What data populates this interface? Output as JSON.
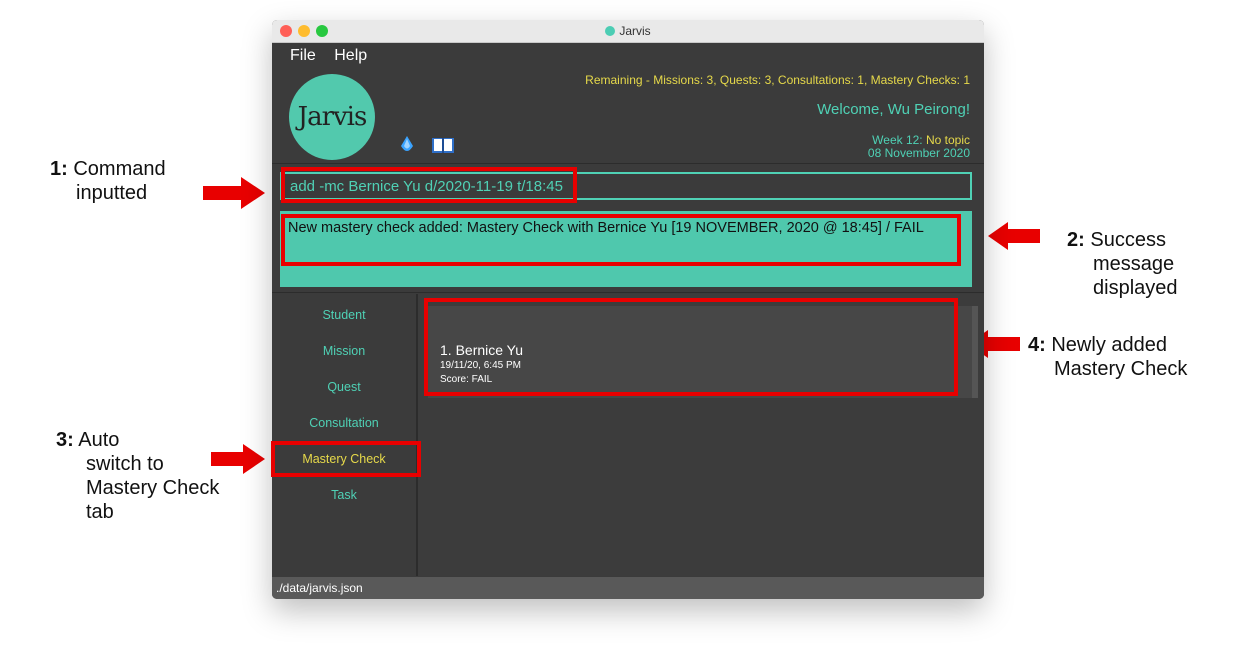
{
  "window": {
    "title": "Jarvis"
  },
  "menu": {
    "file": "File",
    "help": "Help"
  },
  "header": {
    "logo_text": "Jarvis",
    "remaining": "Remaining - Missions: 3, Quests: 3, Consultations: 1, Mastery Checks: 1",
    "welcome": "Welcome, Wu Peirong!",
    "week_label": "Week 12: ",
    "week_topic": "No topic",
    "date": "08 November 2020"
  },
  "command": {
    "value": "add -mc Bernice Yu d/2020-11-19 t/18:45"
  },
  "result": {
    "message": "New mastery check added: Mastery Check with Bernice Yu [19 NOVEMBER, 2020 @ 18:45] / FAIL"
  },
  "tabs": [
    {
      "label": "Student"
    },
    {
      "label": "Mission"
    },
    {
      "label": "Quest"
    },
    {
      "label": "Consultation"
    },
    {
      "label": "Mastery Check",
      "active": true
    },
    {
      "label": "Task"
    }
  ],
  "list": [
    {
      "name": "1.  Bernice Yu",
      "datetime": "19/11/20, 6:45 PM",
      "score": "Score: FAIL"
    }
  ],
  "status": {
    "path": "./data/jarvis.json"
  },
  "annotations": {
    "a1_num": "1:",
    "a1_line1": "Command",
    "a1_line2": "inputted",
    "a2_num": "2:",
    "a2_line1": "Success",
    "a2_line2": "message",
    "a2_line3": "displayed",
    "a3_num": "3:",
    "a3_line1": "Auto",
    "a3_line2": "switch to",
    "a3_line3": "Mastery Check",
    "a3_line4": "tab",
    "a4_num": "4:",
    "a4_line1": "Newly added",
    "a4_line2": "Mastery Check"
  },
  "colors": {
    "accent": "#4fd1b5",
    "highlight": "#e6d94a",
    "annotation": "#e80000"
  }
}
